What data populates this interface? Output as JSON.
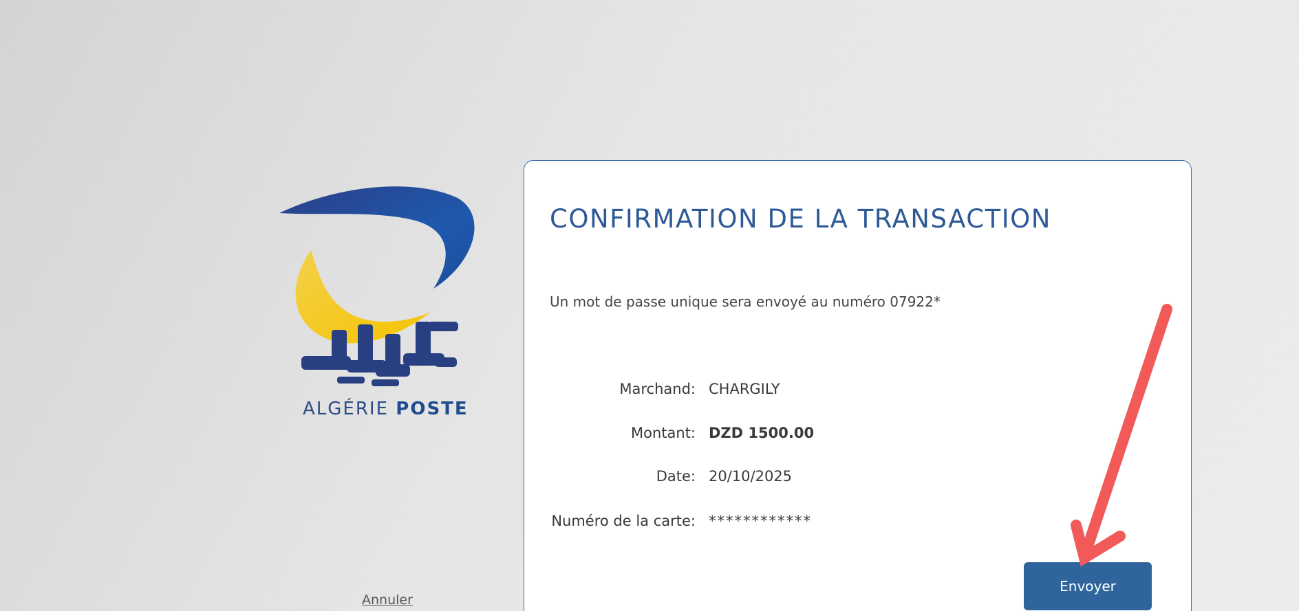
{
  "logo": {
    "brand_part1": "ALGÉRIE ",
    "brand_part2": "POSTE",
    "icon": "algerie-poste-logo"
  },
  "panel": {
    "title": "CONFIRMATION DE LA TRANSACTION",
    "otp_message": "Un mot de passe unique sera envoyé au numéro 07922*",
    "details": [
      {
        "label": "Marchand:",
        "value": "CHARGILY"
      },
      {
        "label": "Montant:",
        "value": "DZD 1500.00"
      },
      {
        "label": "Date:",
        "value": "20/10/2025"
      },
      {
        "label": "Numéro de la carte:",
        "value": "************"
      }
    ],
    "send_label": "Envoyer"
  },
  "cancel_label": "Annuler",
  "colors": {
    "accent": "#2f659c",
    "title": "#2d5a96",
    "logo_blue": "#1f4c8f",
    "logo_yellow": "#f5c518",
    "arrow": "#f25a5a"
  },
  "annotation": {
    "icon": "red-arrow-pointer"
  }
}
